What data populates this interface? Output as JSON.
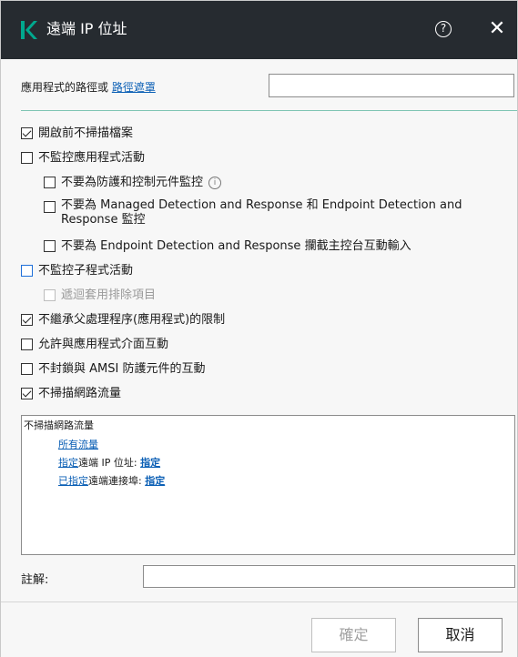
{
  "window": {
    "title": "遠端 IP 位址",
    "help_glyph": "?",
    "close_glyph": "✕"
  },
  "path": {
    "label_prefix": "應用程式的路徑或 ",
    "label_link": "路徑遮罩",
    "value": ""
  },
  "options": [
    {
      "label": "開啟前不掃描檔案",
      "checked": true
    },
    {
      "label": "不監控應用程式活動",
      "checked": false
    },
    {
      "label": "不要為防護和控制元件監控",
      "checked": false,
      "info_glyph": "i"
    },
    {
      "label": "不要為 Managed Detection and Response 和 Endpoint Detection and Response 監控",
      "checked": false
    },
    {
      "label": "不要為 Endpoint Detection and Response 攔截主控台互動輸入",
      "checked": false
    },
    {
      "label": "不監控子程式活動",
      "checked": false
    },
    {
      "label": "遞迴套用排除項目",
      "checked": false,
      "disabled": true
    },
    {
      "label": "不繼承父處理程序(應用程式)的限制",
      "checked": true
    },
    {
      "label": "允許與應用程式介面互動",
      "checked": false
    },
    {
      "label": "不封鎖與 AMSI 防護元件的互動",
      "checked": false
    },
    {
      "label": "不掃描網路流量",
      "checked": true
    }
  ],
  "rule": {
    "heading": "不掃描網路流量",
    "all_traffic": "所有流量",
    "line2_link": "指定",
    "line2_text": "遠端 IP 位址: ",
    "line2_value": "指定",
    "line3_link": "已指定",
    "line3_text": "遠端連接埠: ",
    "line3_value": "指定"
  },
  "comment": {
    "label": "註解:",
    "value": ""
  },
  "buttons": {
    "ok": "確定",
    "cancel": "取消"
  },
  "colors": {
    "titlebar": "#262b30",
    "brand": "#00a88e",
    "link": "#0b5fb5",
    "divider": "#7fc4b3"
  }
}
